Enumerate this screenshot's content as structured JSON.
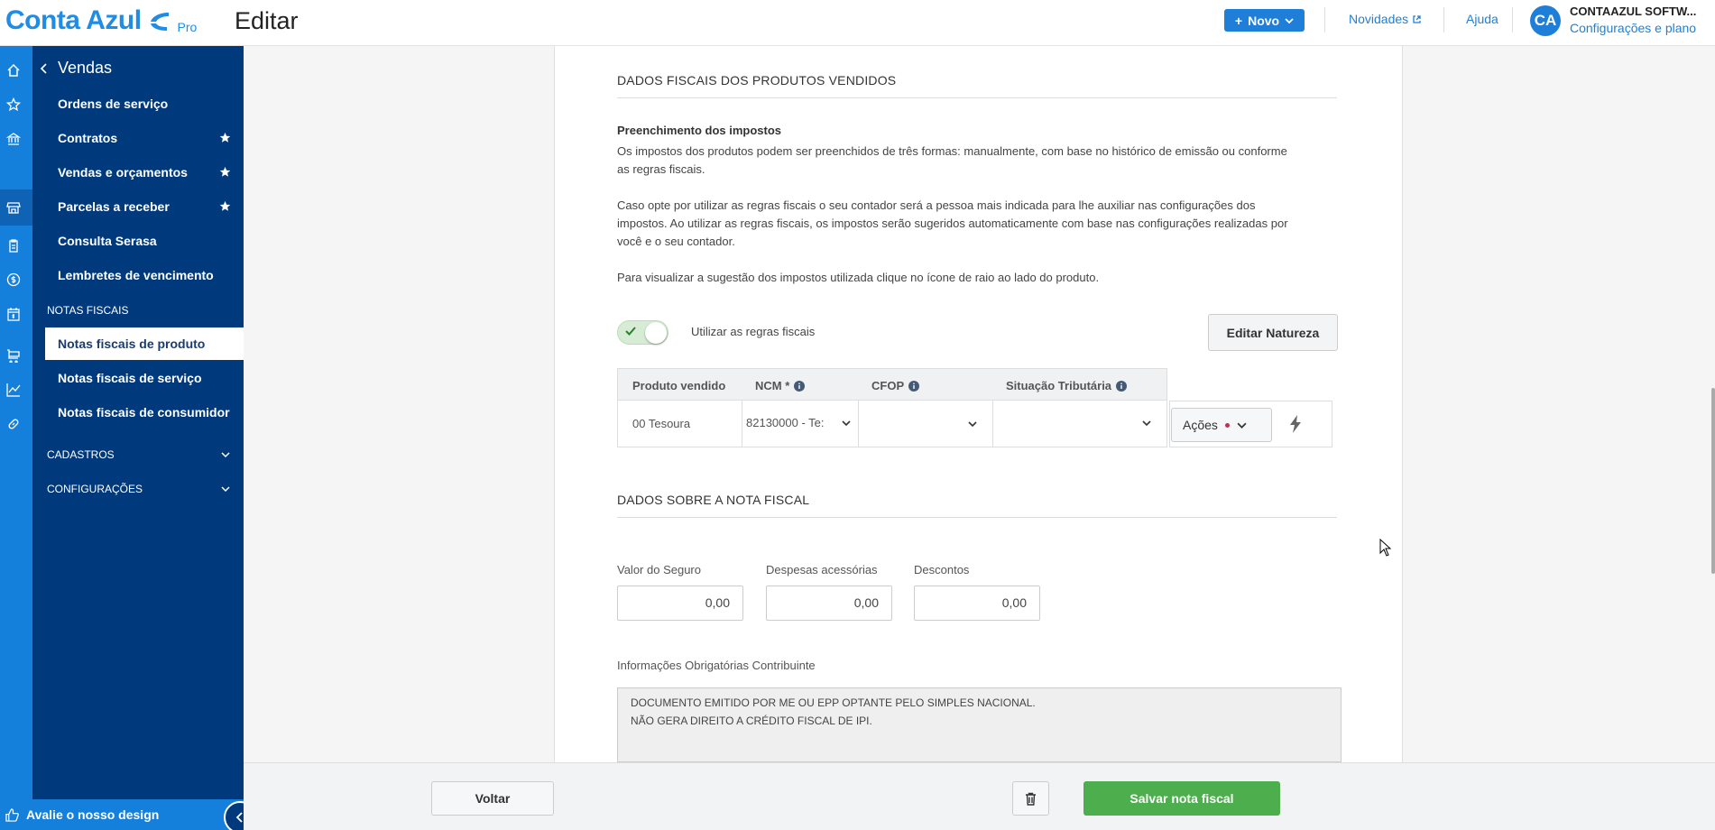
{
  "header": {
    "logo_text": "Conta Azul",
    "logo_badge": "Pro",
    "page_title": "Editar",
    "new_button": "Novo",
    "links": {
      "news": "Novidades",
      "help": "Ajuda"
    },
    "avatar_initials": "CA",
    "company_name": "CONTAAZUL SOFTW...",
    "company_sub": "Configurações e plano",
    "brand_color": "#1f8ce6"
  },
  "sidebar": {
    "title": "Vendas",
    "items": [
      {
        "label": "Ordens de serviço",
        "starred": false
      },
      {
        "label": "Contratos",
        "starred": true
      },
      {
        "label": "Vendas e orçamentos",
        "starred": true
      },
      {
        "label": "Parcelas a receber",
        "starred": true
      },
      {
        "label": "Consulta Serasa",
        "starred": false
      },
      {
        "label": "Lembretes de vencimento",
        "starred": false
      }
    ],
    "section_notas": "NOTAS FISCAIS",
    "notas_items": [
      {
        "label": "Notas fiscais de produto",
        "active": true
      },
      {
        "label": "Notas fiscais de serviço",
        "active": false
      },
      {
        "label": "Notas fiscais de consumidor",
        "active": false
      }
    ],
    "collapsibles": [
      "CADASTROS",
      "CONFIGURAÇÕES"
    ],
    "footer_label": "Avalie o nosso design",
    "rail_icons": [
      "home-icon",
      "star-icon",
      "bank-icon",
      "store-icon",
      "clipboard-icon",
      "dollar-icon",
      "calendar-dollar-icon",
      "cart-icon",
      "chart-icon",
      "link-icon"
    ]
  },
  "main": {
    "section1_title": "DADOS FISCAIS DOS PRODUTOS VENDIDOS",
    "subtitle": "Preenchimento dos impostos",
    "paragraph1_line1": "Os impostos dos produtos podem ser preenchidos de três formas: manualmente, com base no histórico de emissão ou conforme",
    "paragraph1_line2": "as regras fiscais.",
    "paragraph2_line1": "Caso opte por utilizar as regras fiscais o seu contador será a pessoa mais indicada para lhe auxiliar nas configurações dos",
    "paragraph2_line2": "impostos. Ao utilizar as regras fiscais, os impostos serão sugeridos automaticamente com base nas configurações realizadas por",
    "paragraph2_line3": "você e o seu contador.",
    "paragraph3": "Para visualizar a sugestão dos impostos utilizada clique no ícone de raio ao lado do produto.",
    "toggle_label": "Utilizar as regras fiscais",
    "toggle_on": true,
    "edit_natureza": "Editar Natureza",
    "table": {
      "headers": [
        "Produto vendido",
        "NCM *",
        "CFOP",
        "Situação Tributária"
      ],
      "row": {
        "produto": "00 Tesoura",
        "ncm": "82130000 - Te:",
        "cfop": "",
        "situacao": ""
      },
      "actions_label": "Ações"
    },
    "section2_title": "DADOS SOBRE A NOTA FISCAL",
    "fields": [
      {
        "label": "Valor do Seguro",
        "value": "0,00"
      },
      {
        "label": "Despesas acessórias",
        "value": "0,00"
      },
      {
        "label": "Descontos",
        "value": "0,00"
      }
    ],
    "info_label": "Informações Obrigatórias Contribuinte",
    "info_line1": "DOCUMENTO EMITIDO POR ME OU EPP OPTANTE PELO SIMPLES NACIONAL.",
    "info_line2": "NÃO GERA DIREITO A CRÉDITO FISCAL DE IPI."
  },
  "footer": {
    "back": "Voltar",
    "save": "Salvar nota fiscal",
    "save_color": "#4cae4c"
  }
}
